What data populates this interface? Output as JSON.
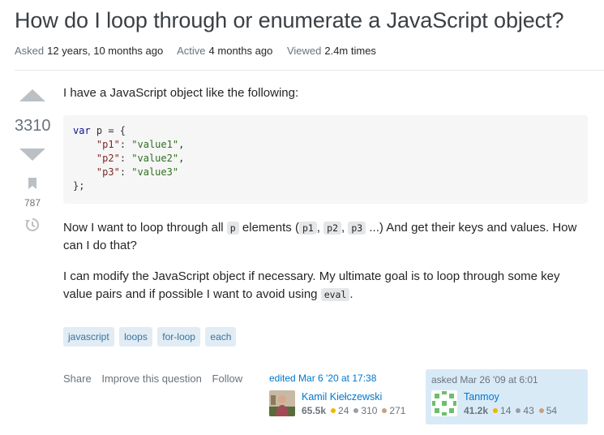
{
  "question": {
    "title": "How do I loop through or enumerate a JavaScript object?",
    "meta": {
      "asked_label": "Asked",
      "asked_value": "12 years, 10 months ago",
      "active_label": "Active",
      "active_value": "4 months ago",
      "viewed_label": "Viewed",
      "viewed_value": "2.4m times"
    },
    "score": "3310",
    "bookmark_count": "787",
    "body": {
      "intro": "I have a JavaScript object like the following:",
      "code_lines": [
        {
          "kw": "var",
          "rest": " p = {"
        },
        {
          "key": "\"p1\"",
          "val": "\"value1\"",
          "sep": ","
        },
        {
          "key": "\"p2\"",
          "val": "\"value2\"",
          "sep": ","
        },
        {
          "key": "\"p3\"",
          "val": "\"value3\"",
          "sep": ""
        },
        {
          "rest": "};"
        }
      ],
      "p2_before": "Now I want to loop through all",
      "p2_code_p": "p",
      "p2_mid": "elements (",
      "p2_code_p1": "p1",
      "p2_code_p2": "p2",
      "p2_code_p3": "p3",
      "p2_after": "...) And get their keys and values. How can I do that?",
      "p3_before": "I can modify the JavaScript object if necessary. My ultimate goal is to loop through some key value pairs and if possible I want to avoid using",
      "p3_code": "eval",
      "p3_after": "."
    },
    "tags": [
      "javascript",
      "loops",
      "for-loop",
      "each"
    ],
    "actions": [
      "Share",
      "Improve this question",
      "Follow"
    ],
    "edited": {
      "when": "edited Mar 6 '20 at 17:38",
      "user": "Kamil Kiełczewski",
      "rep": "65.5k",
      "gold": "24",
      "silver": "310",
      "bronze": "271"
    },
    "asked": {
      "when": "asked Mar 26 '09 at 6:01",
      "user": "Tanmoy",
      "rep": "41.2k",
      "gold": "14",
      "silver": "43",
      "bronze": "54"
    }
  },
  "colors": {
    "link": "#0077cc",
    "tag_bg": "#e1ecf4",
    "tag_text": "#39739d",
    "owner_card_bg": "#d9eaf7",
    "gold": "#f1b600",
    "silver": "#9a9ea2",
    "bronze": "#c8a080"
  }
}
